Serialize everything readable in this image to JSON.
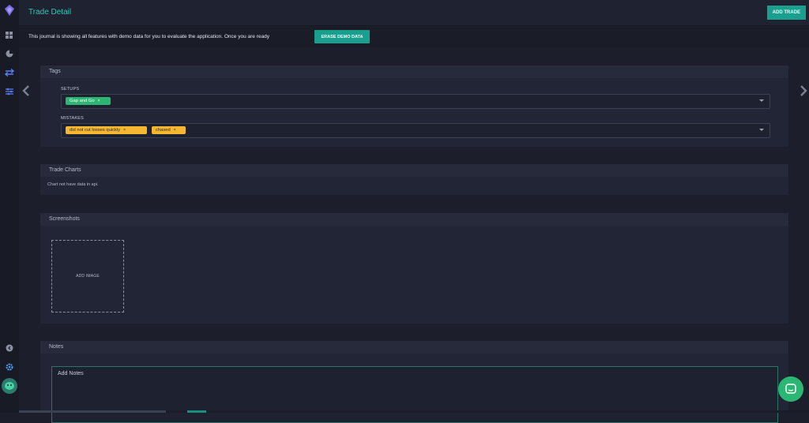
{
  "header": {
    "title": "Trade Detail",
    "add_trade": "ADD TRADE"
  },
  "demo": {
    "message": "This journal is showing all features with demo data for you to evaluate the application. Once you are ready",
    "erase_button": "ERASE DEMO DATA"
  },
  "sidebar": {
    "items": [
      "logo-icon",
      "dashboard-icon",
      "reports-icon",
      "trades-icon",
      "filters-icon"
    ],
    "bottom": [
      "collapse-icon",
      "settings-icon",
      "avatar"
    ]
  },
  "tags": {
    "title": "Tags",
    "setups_label": "SETUPS",
    "setups": [
      {
        "label": "Gap and Go",
        "x": "×"
      }
    ],
    "mistakes_label": "MISTAKES",
    "mistakes": [
      {
        "label": "did not cut losses quickly",
        "x": "×"
      },
      {
        "label": "chased",
        "x": "×"
      }
    ]
  },
  "charts": {
    "title": "Trade Charts",
    "message": "Chart not have data in api."
  },
  "screenshots": {
    "title": "Screenshots",
    "add_image": "ADD IMAGE"
  },
  "notes": {
    "title": "Notes",
    "placeholder": "Add Notes"
  },
  "colors": {
    "accent": "#1a9e8d",
    "title": "#2ec7b3",
    "green_tag": "#2bb673",
    "yellow_tag": "#f5b731"
  }
}
